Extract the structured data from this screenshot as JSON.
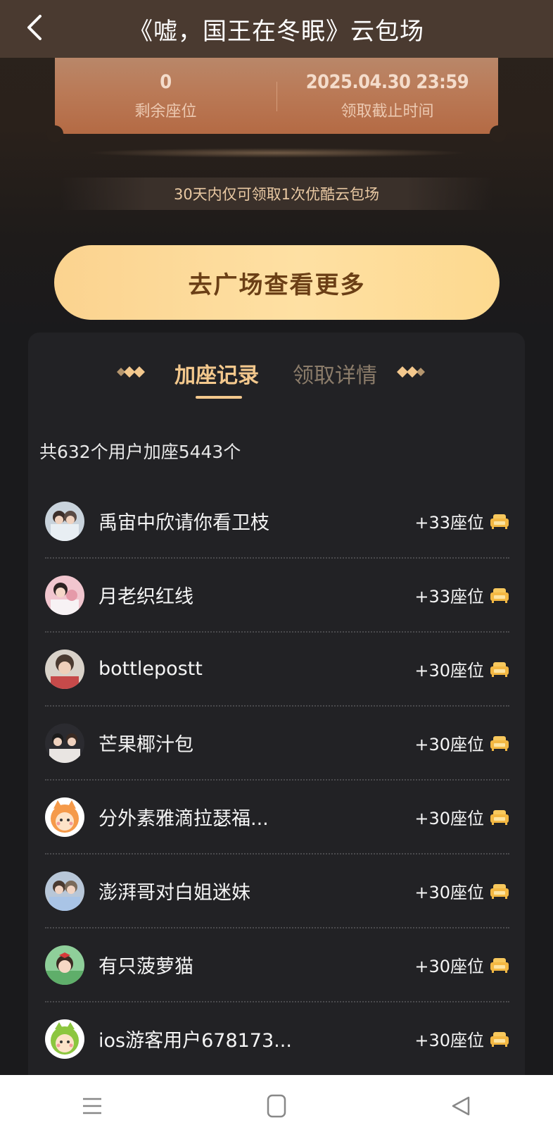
{
  "header": {
    "title": "《嘘，国王在冬眠》云包场"
  },
  "ticket": {
    "remaining_value": "0",
    "remaining_label": "剩余座位",
    "deadline_value": "2025.04.30 23:59",
    "deadline_label": "领取截止时间"
  },
  "notice": "30天内仅可领取1次优酷云包场",
  "cta_label": "去广场查看更多",
  "tabs": [
    {
      "label": "加座记录",
      "active": true
    },
    {
      "label": "领取详情",
      "active": false
    }
  ],
  "summary": "共632个用户加座5443个",
  "records": [
    {
      "name": "禹宙中欣请你看卫枝",
      "seats": "+33座位",
      "avatar": "photo-avatar"
    },
    {
      "name": "月老织红线",
      "seats": "+33座位",
      "avatar": "photo-avatar"
    },
    {
      "name": "bottlepostt",
      "seats": "+30座位",
      "avatar": "photo-avatar"
    },
    {
      "name": "芒果椰汁包",
      "seats": "+30座位",
      "avatar": "photo-avatar"
    },
    {
      "name": "分外素雅滴拉瑟福...",
      "seats": "+30座位",
      "avatar": "cartoon-orange-avatar"
    },
    {
      "name": "澎湃哥对白姐迷妹",
      "seats": "+30座位",
      "avatar": "photo-avatar"
    },
    {
      "name": "有只菠萝猫",
      "seats": "+30座位",
      "avatar": "cartoon-girl-avatar"
    },
    {
      "name": "ios游客用户678173...",
      "seats": "+30座位",
      "avatar": "cartoon-green-avatar"
    }
  ],
  "colors": {
    "accent_gold": "#f3c88d",
    "cta_gradient_start": "#fbd38f",
    "panel_bg": "#222225",
    "ticket_bg": "#b97a57"
  },
  "navbar": {
    "icons": [
      "menu-icon",
      "home-icon",
      "back-triangle-icon"
    ]
  }
}
